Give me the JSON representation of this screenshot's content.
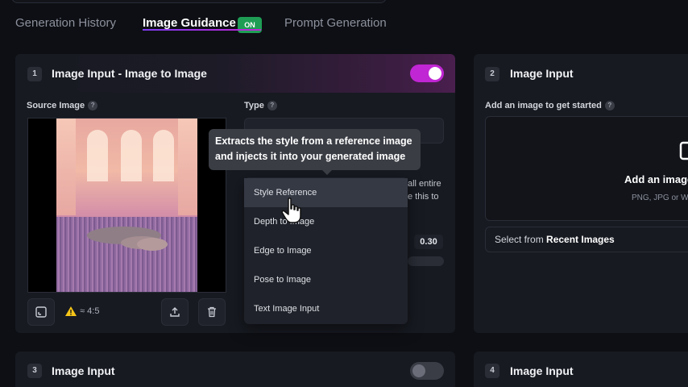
{
  "tabs": [
    {
      "label": "Generation History"
    },
    {
      "label": "Image Guidance",
      "badge": "ON"
    },
    {
      "label": "Prompt Generation"
    }
  ],
  "card1": {
    "number": "1",
    "title": "Image Input - Image to Image",
    "toggle_on": true,
    "source_label": "Source Image",
    "type_label": "Type",
    "aspect": "≈ 4:5",
    "type_desc_line1": "all entire",
    "type_desc_line2": "e this to",
    "strength_value": "0.30"
  },
  "tooltip": {
    "line1": "Extracts the style from a reference image",
    "line2": "and injects it into your generated image"
  },
  "dropdown": {
    "options": [
      "Style Reference",
      "Depth to Image",
      "Edge to Image",
      "Pose to Image",
      "Text Image Input"
    ],
    "hovered": "Style Reference"
  },
  "card2": {
    "number": "2",
    "title": "Image Input",
    "add_label": "Add an image to get started",
    "drop_title": "Add an image",
    "drop_formats": "PNG, JPG or W",
    "recent_prefix": "Select from ",
    "recent_bold": "Recent Images"
  },
  "card3": {
    "number": "3",
    "title": "Image Input",
    "toggle_on": false
  },
  "card4": {
    "number": "4",
    "title": "Image Input"
  },
  "colors": {
    "accent": "#c026d3",
    "badge_on": "#1f9d55",
    "warning": "#f5c518"
  }
}
